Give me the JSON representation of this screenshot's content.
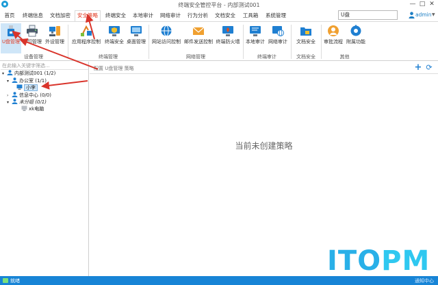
{
  "window": {
    "title": "终端安全管控平台 - 内部测试001",
    "minimize": "—",
    "maximize": "□",
    "close": "✕"
  },
  "menu": {
    "tabs": [
      {
        "label": "首页"
      },
      {
        "label": "终端信息"
      },
      {
        "label": "文档加密"
      },
      {
        "label": "安全策略"
      },
      {
        "label": "终端安全"
      },
      {
        "label": "本地审计"
      },
      {
        "label": "网络审计"
      },
      {
        "label": "行为分析"
      },
      {
        "label": "文档安全"
      },
      {
        "label": "工具箱"
      },
      {
        "label": "系统管理"
      }
    ],
    "active_index": 3
  },
  "search": {
    "value": "U盘"
  },
  "user": {
    "name": "admin",
    "caret": "▼"
  },
  "ribbon": {
    "buttons": [
      {
        "label": "U盘管理",
        "icon": "usb-drive-icon"
      },
      {
        "label": "打印管理",
        "icon": "printer-icon"
      },
      {
        "label": "外设管理",
        "icon": "peripheral-icon"
      },
      {
        "label": "应用程序控制",
        "icon": "app-control-icon"
      },
      {
        "label": "终端安全",
        "icon": "shield-monitor-icon"
      },
      {
        "label": "桌面管理",
        "icon": "desktop-icon"
      },
      {
        "label": "网站访问控制",
        "icon": "globe-icon"
      },
      {
        "label": "邮件发送控制",
        "icon": "mail-icon"
      },
      {
        "label": "终端防火墙",
        "icon": "firewall-icon"
      },
      {
        "label": "本地审计",
        "icon": "local-audit-icon"
      },
      {
        "label": "网络审计",
        "icon": "network-audit-icon"
      },
      {
        "label": "文档安全",
        "icon": "document-folder-icon"
      },
      {
        "label": "审批流程",
        "icon": "approval-icon"
      },
      {
        "label": "附属功能",
        "icon": "gear-icon"
      }
    ],
    "selected_index": 0,
    "groups": [
      {
        "label": "设备管理"
      },
      {
        "label": "终端管理"
      },
      {
        "label": "网络管理"
      },
      {
        "label": "终端审计"
      },
      {
        "label": "文档安全"
      },
      {
        "label": "其他"
      }
    ]
  },
  "tree": {
    "search_placeholder": "在此输入关键字筛选...",
    "nodes": [
      {
        "label": "内部测试001 (1/2)",
        "twist": "▾",
        "icon": "group-icon"
      },
      {
        "label": "办公室 (1/1)",
        "twist": "▾",
        "icon": "group-icon"
      },
      {
        "label": "小李",
        "twist": "",
        "icon": "computer-online-icon"
      },
      {
        "label": "信息中心 (0/0)",
        "twist": "›",
        "icon": "group-icon"
      },
      {
        "label": "未分组 (0/1)",
        "twist": "▾",
        "icon": "group-icon"
      },
      {
        "label": "xk电脑",
        "twist": "",
        "icon": "computer-offline-icon"
      }
    ],
    "selected_index": 2
  },
  "content": {
    "breadcrumb": "配置 U盘管理 策略",
    "add": "+",
    "refresh": "⟳",
    "empty_message": "当前未创建策略"
  },
  "status": {
    "text": "就绪",
    "right": "通知中心"
  },
  "watermark": {
    "part1": "ITO",
    "part2": "PM"
  },
  "colors": {
    "accent": "#1784d6",
    "active_tab": "#e0381f",
    "arrow": "#d9342b"
  }
}
